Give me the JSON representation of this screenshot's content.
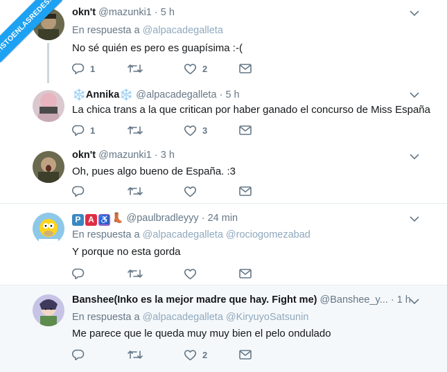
{
  "watermark": "VISTOENLASREDES.COM",
  "tweets": [
    {
      "name": "okn't",
      "handle": "@mazunki1",
      "time": "5 h",
      "reply_prefix": "En respuesta a",
      "reply_to": "@alpacadegalleta",
      "text": "No sé quién es pero es guapísima :-(",
      "replies": "1",
      "retweets": "",
      "likes": "2"
    },
    {
      "name": "Annika",
      "name_prefix_emoji": "❄️",
      "name_suffix_emoji": "❄️",
      "handle": "@alpacadegalleta",
      "time": "5 h",
      "text": "La chica trans a la que critican por haber ganado el concurso de Miss España",
      "replies": "1",
      "retweets": "",
      "likes": "3"
    },
    {
      "name": "okn't",
      "handle": "@mazunki1",
      "time": "3 h",
      "text": "Oh, pues algo bueno de España. :3",
      "replies": "",
      "retweets": "",
      "likes": ""
    },
    {
      "name_emojis": [
        "P",
        "A",
        "♿",
        "👢"
      ],
      "handle": "@paulbradleyyy",
      "time": "24 min",
      "reply_prefix": "En respuesta a",
      "reply_to": "@alpacadegalleta @rociogomezabad",
      "text": "Y porque no esta gorda",
      "replies": "",
      "retweets": "",
      "likes": ""
    },
    {
      "name": "Banshee(Inko es la mejor madre que hay. Fight me)",
      "handle": "@Banshee_y...",
      "time": "1 h",
      "reply_prefix": "En respuesta a",
      "reply_to": "@alpacadegalleta @KiryuyoSatsunin",
      "text": "Me parece que le queda muy muy bien el pelo ondulado",
      "replies": "",
      "retweets": "",
      "likes": "2"
    }
  ],
  "separator": "·",
  "colors": {
    "accent": "#1da1f2",
    "muted": "#657786",
    "thread": "#ccd6dd"
  },
  "icons": [
    "reply-icon",
    "retweet-icon",
    "like-icon",
    "dm-icon",
    "chevron-down-icon"
  ]
}
